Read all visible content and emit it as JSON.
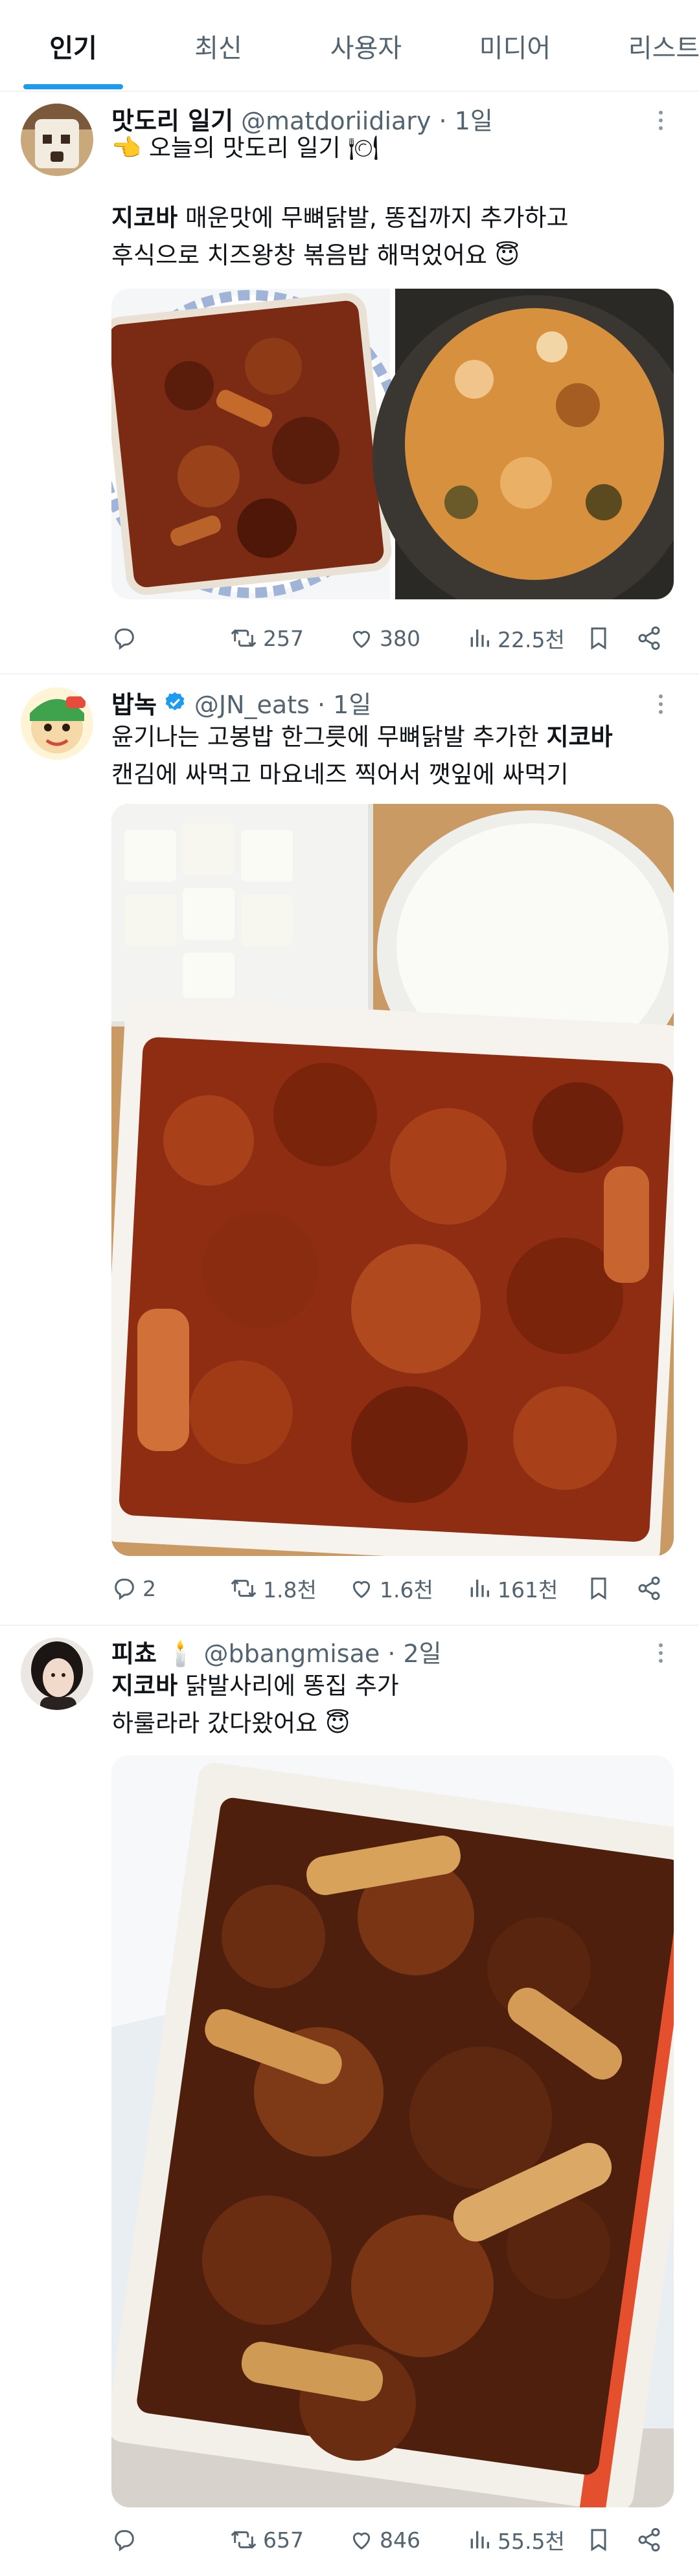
{
  "tabs": [
    {
      "label": "인기",
      "active": true
    },
    {
      "label": "최신",
      "active": false
    },
    {
      "label": "사용자",
      "active": false
    },
    {
      "label": "미디어",
      "active": false
    },
    {
      "label": "리스트",
      "active": false
    }
  ],
  "tweets": [
    {
      "name": "맛도리 일기",
      "handle": "@matdoriidiary · 1일",
      "line1": "오늘의 맛도리 일기",
      "line2_bold": "지코바",
      "line2_rest": " 매운맛에 무뼈닭발, 똥집까지 추가하고",
      "line3": "후식으로 치즈왕창 볶음밥 해먹었어요 😇",
      "stats": {
        "replies": "",
        "retweets": "257",
        "likes": "380",
        "views": "22.5천"
      }
    },
    {
      "name": "밥녹",
      "handle": "@JN_eats · 1일",
      "line1_pre": "윤기나는 고봉밥 한그릇에 무뼈닭발 추가한 ",
      "line1_bold": "지코바",
      "line2": "캔김에 싸먹고 마요네즈 찍어서 깻잎에 싸먹기",
      "stats": {
        "replies": "2",
        "retweets": "1.8천",
        "likes": "1.6천",
        "views": "161천"
      }
    },
    {
      "name": "피쵸 🕯️",
      "handle": "@bbangmisae · 2일",
      "line1_bold": "지코바",
      "line1_rest": " 닭발사리에 똥집 추가",
      "line2": "하룰라라 갔다왔어요 😇",
      "stats": {
        "replies": "",
        "retweets": "657",
        "likes": "846",
        "views": "55.5천"
      }
    }
  ],
  "icons": {
    "reply": "reply-icon",
    "retweet": "retweet-icon",
    "like": "heart-icon",
    "views": "views-icon",
    "bookmark": "bookmark-icon",
    "share": "share-icon"
  },
  "colors": {
    "accent": "#1d9bf0",
    "muted": "#536471",
    "text": "#0f1419"
  }
}
